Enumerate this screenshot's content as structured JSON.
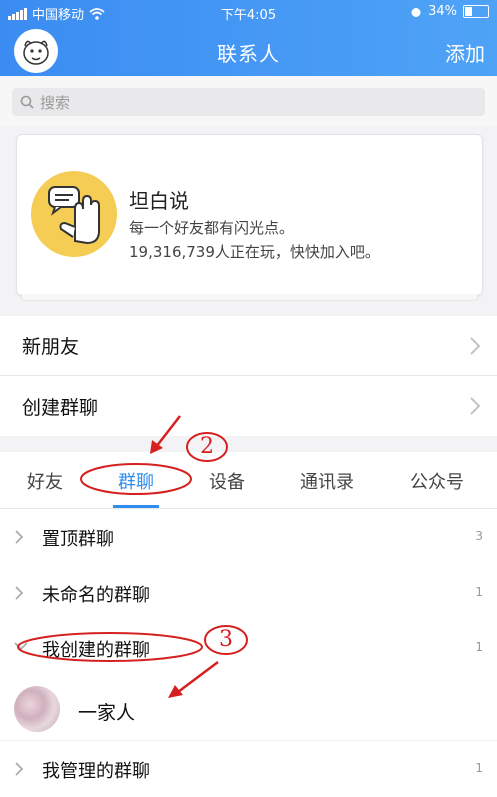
{
  "status_bar": {
    "carrier": "中国移动",
    "time": "下午4:05",
    "battery": "34%"
  },
  "nav": {
    "title": "联系人",
    "add_label": "添加",
    "avatar_icon": "cartoon-avatar"
  },
  "search": {
    "placeholder": "搜索"
  },
  "promo_card": {
    "title": "坦白说",
    "line1": "每一个好友都有闪光点。",
    "line2": "19,316,739人正在玩，快快加入吧。",
    "icon": "hand-speech-bubble-icon"
  },
  "menu": [
    {
      "label": "新朋友"
    },
    {
      "label": "创建群聊"
    }
  ],
  "tabs": [
    {
      "label": "好友",
      "active": false
    },
    {
      "label": "群聊",
      "active": true
    },
    {
      "label": "设备",
      "active": false
    },
    {
      "label": "通讯录",
      "active": false
    },
    {
      "label": "公众号",
      "active": false
    }
  ],
  "group_sections": [
    {
      "label": "置顶群聊",
      "count": "3",
      "expanded": false
    },
    {
      "label": "未命名的群聊",
      "count": "1",
      "expanded": false
    },
    {
      "label": "我创建的群聊",
      "count": "1",
      "expanded": true
    },
    {
      "label": "我管理的群聊",
      "count": "1",
      "expanded": false
    }
  ],
  "group_member": {
    "name": "一家人"
  },
  "annotations": [
    {
      "label": "2"
    },
    {
      "label": "3"
    }
  ],
  "colors": {
    "accent": "#2e8ded",
    "header": "#4a9cf5",
    "annotation": "#d62020",
    "promo_icon_bg": "#f5cd55"
  }
}
